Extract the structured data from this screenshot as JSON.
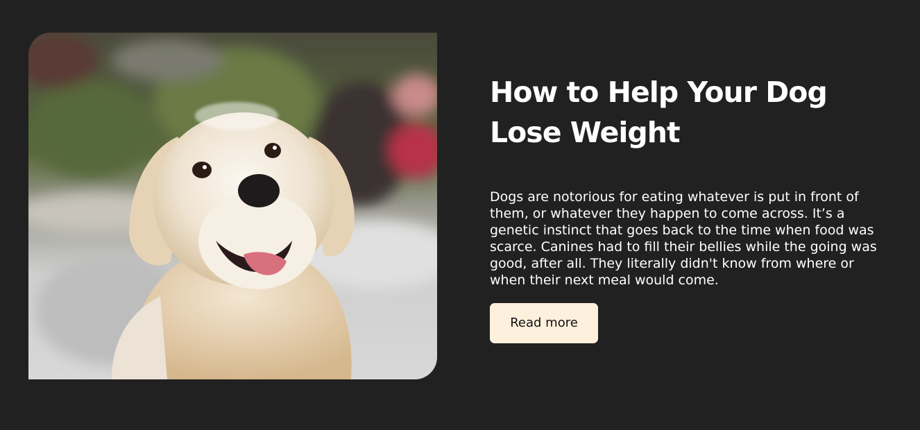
{
  "article": {
    "image_alt": "Golden retriever dog",
    "title": "How to Help Your Dog Lose Weight",
    "description": "Dogs are notorious for eating whatever is put in front of them, or whatever they happen to come across. It’s a genetic instinct that goes back to the time when food was scarce. Canines had to fill their bellies while the going was good, after all. They literally didn't know from where or when their next meal would come.",
    "button_label": "Read more"
  },
  "colors": {
    "background": "#212121",
    "text": "#ffffff",
    "button_bg": "#fdf0dc",
    "button_text": "#111111"
  }
}
